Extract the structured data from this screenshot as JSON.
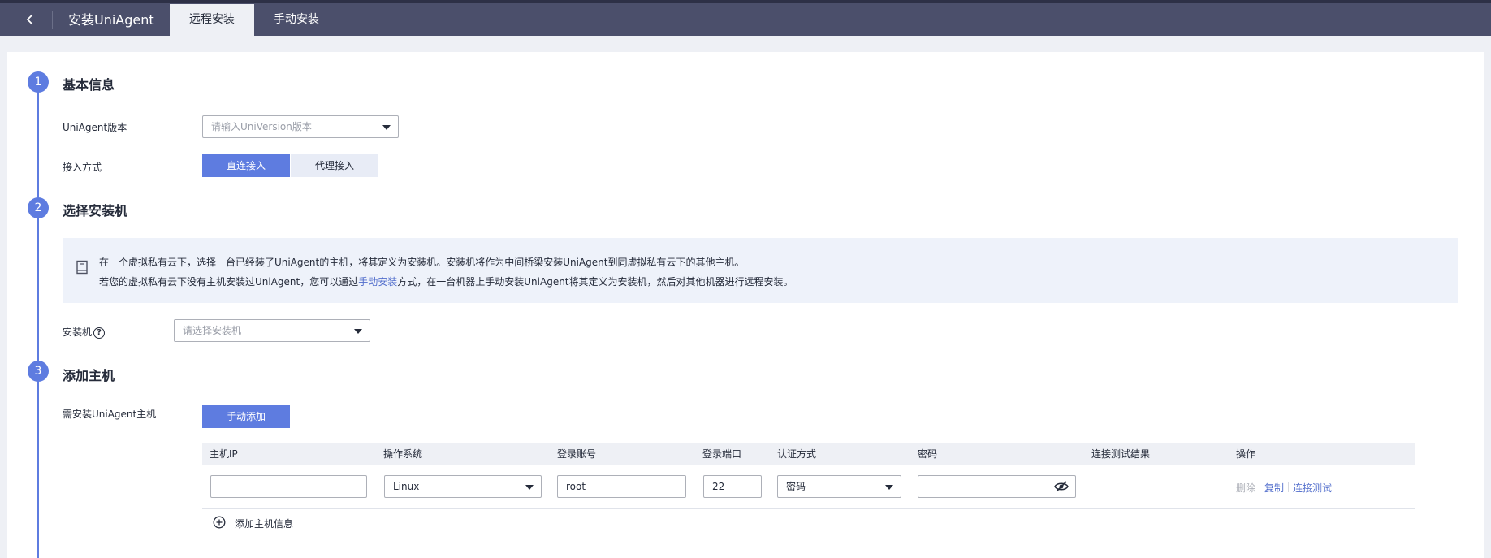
{
  "header": {
    "back_icon": "chevron-left-icon",
    "title": "安装UniAgent",
    "tabs": [
      {
        "label": "远程安装",
        "active": true
      },
      {
        "label": "手动安装",
        "active": false
      }
    ]
  },
  "colors": {
    "header_bg": "#4b4f6b",
    "accent": "#5e7ce0",
    "link": "#526ecc",
    "info_bg": "#eef2fa"
  },
  "steps": [
    {
      "number": "1",
      "title": "基本信息"
    },
    {
      "number": "2",
      "title": "选择安装机"
    },
    {
      "number": "3",
      "title": "添加主机"
    }
  ],
  "basic": {
    "version_label": "UniAgent版本",
    "version_placeholder": "请输入UniVersion版本",
    "access_label": "接入方式",
    "access_options": [
      "直连接入",
      "代理接入"
    ],
    "access_selected": "直连接入"
  },
  "installer": {
    "info_icon": "book-icon",
    "info_line1": "在一个虚拟私有云下，选择一台已经装了UniAgent的主机，将其定义为安装机。安装机将作为中间桥梁安装UniAgent到同虚拟私有云下的其他主机。",
    "info_line2_pre": "若您的虚拟私有云下没有主机安装过UniAgent，您可以通过",
    "info_line2_link": "手动安装",
    "info_line2_post": "方式，在一台机器上手动安装UniAgent将其定义为安装机，然后对其他机器进行远程安装。",
    "label": "安装机",
    "help_icon": "question-circle-icon",
    "help_glyph": "?",
    "placeholder": "请选择安装机"
  },
  "hosts": {
    "label": "需安装UniAgent主机",
    "add_button": "手动添加",
    "columns": [
      "主机IP",
      "操作系统",
      "登录账号",
      "登录端口",
      "认证方式",
      "密码",
      "连接测试结果",
      "操作"
    ],
    "rows": [
      {
        "ip": "",
        "os": "Linux",
        "account": "root",
        "port": "22",
        "auth": "密码",
        "password": "",
        "test_result": "--",
        "actions": [
          "删除",
          "复制",
          "连接测试"
        ]
      }
    ],
    "add_row_label": "添加主机信息",
    "add_row_icon": "plus-circle-icon"
  }
}
